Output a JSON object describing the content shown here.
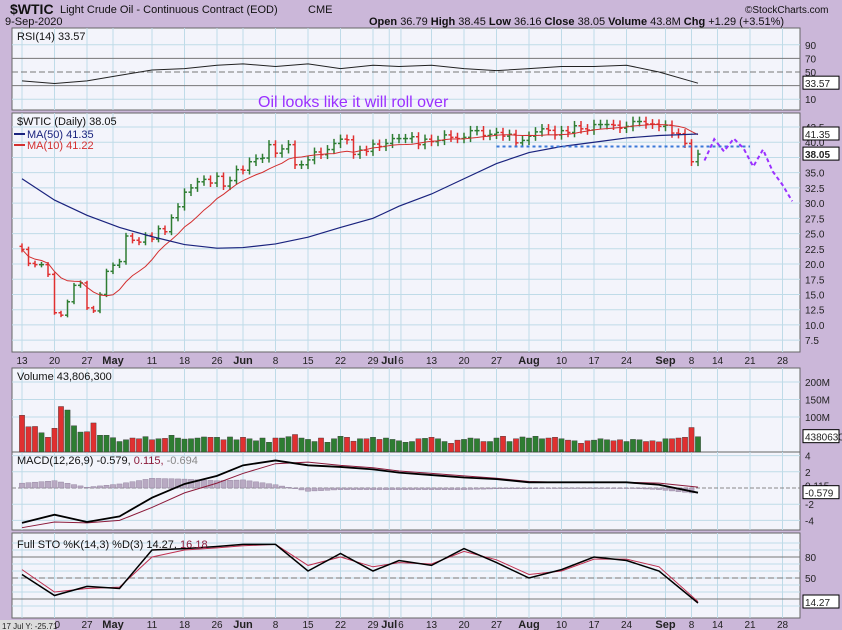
{
  "chart_data": {
    "type": "ohlc",
    "header": {
      "symbol": "$WTIC",
      "name": "Light Crude Oil - Continuous Contract (EOD)",
      "exchange": "CME",
      "date": "9-Sep-2020",
      "brand": "©StockCharts.com",
      "open_label": "Open",
      "open": "36.79",
      "high_label": "High",
      "high": "38.45",
      "low_label": "Low",
      "low": "36.16",
      "close_label": "Close",
      "close": "38.05",
      "volume_label": "Volume",
      "volume": "43.8M",
      "chg_label": "Chg",
      "chg": "+1.29 (+3.51%)"
    },
    "annotation": "Oil looks like it will roll over",
    "x_labels": [
      {
        "label": "13",
        "idx": 0
      },
      {
        "label": "20",
        "idx": 5
      },
      {
        "label": "27",
        "idx": 10
      },
      {
        "label": "May",
        "idx": 14,
        "bold": true
      },
      {
        "label": "11",
        "idx": 20
      },
      {
        "label": "18",
        "idx": 25
      },
      {
        "label": "26",
        "idx": 30
      },
      {
        "label": "Jun",
        "idx": 34,
        "bold": true
      },
      {
        "label": "8",
        "idx": 39
      },
      {
        "label": "15",
        "idx": 44
      },
      {
        "label": "22",
        "idx": 49
      },
      {
        "label": "29",
        "idx": 54
      },
      {
        "label": "Jul",
        "idx": 56.5,
        "bold": true
      },
      {
        "label": "6",
        "idx": 58.3
      },
      {
        "label": "13",
        "idx": 63
      },
      {
        "label": "20",
        "idx": 68
      },
      {
        "label": "27",
        "idx": 73
      },
      {
        "label": "Aug",
        "idx": 78,
        "bold": true
      },
      {
        "label": "10",
        "idx": 83
      },
      {
        "label": "17",
        "idx": 88
      },
      {
        "label": "24",
        "idx": 93
      },
      {
        "label": "Sep",
        "idx": 99,
        "bold": true
      },
      {
        "label": "8",
        "idx": 103
      },
      {
        "label": "14",
        "idx": 107
      },
      {
        "label": "21",
        "idx": 112
      },
      {
        "label": "28",
        "idx": 117
      }
    ],
    "bottom_readout": "17 Jul Y: -25.71",
    "price": {
      "legend": "$WTIC (Daily) 38.05",
      "ma50_label": "MA(50) 41.35",
      "ma50_last": "41.35",
      "ma10_label": "MA(10) 41.22",
      "last": "38.05",
      "ticks": [
        "42.5",
        "40.0",
        "35.0",
        "32.5",
        "30.0",
        "27.5",
        "25.0",
        "22.5",
        "20.0",
        "17.5",
        "15.0",
        "12.5",
        "10.0",
        "7.5"
      ],
      "closes": [
        22.4,
        20.1,
        19.9,
        19.9,
        18.3,
        12,
        11.6,
        13.8,
        16.5,
        16.9,
        12.8,
        12.3,
        15,
        18.8,
        19.8,
        20.4,
        24.6,
        23.9,
        23.6,
        24.7,
        24.1,
        25.8,
        25.3,
        27.6,
        29.4,
        31.8,
        32.5,
        33.5,
        33.9,
        33.3,
        34.4,
        32.8,
        33.7,
        35.5,
        35.4,
        36.8,
        37.3,
        37.4,
        39.6,
        38.2,
        38.9,
        39.6,
        36.3,
        36.3,
        37.1,
        38.4,
        37.96,
        38.8,
        39.8,
        40.5,
        40.4,
        38,
        38.7,
        38.5,
        39.7,
        39.3,
        39.8,
        40.6,
        40.6,
        40.6,
        40.9,
        39.6,
        40.5,
        40.1,
        40.3,
        41.2,
        40.8,
        40.6,
        40.8,
        41.9,
        41.9,
        41.1,
        41.3,
        41.6,
        41,
        41.3,
        39.9,
        40.3,
        41,
        41.7,
        42.2,
        41.95,
        41.2,
        41.9,
        41.6,
        42.7,
        42.2,
        42,
        42.9,
        42.9,
        42.9,
        42.8,
        42.3,
        42.6,
        43.4,
        43.4,
        43,
        42.97,
        42.6,
        42.8,
        41.5,
        41.4,
        39.8,
        36.8,
        38.05
      ],
      "ma50": {
        "idx": [
          0,
          5,
          10,
          15,
          20,
          25,
          30,
          34,
          39,
          44,
          49,
          54,
          58,
          63,
          68,
          73,
          78,
          83,
          88,
          93,
          98,
          104
        ],
        "values": [
          34,
          30.5,
          28,
          26,
          24.5,
          23.2,
          22.6,
          22.7,
          23.3,
          24.4,
          26,
          27.5,
          29.5,
          31.5,
          34,
          36.5,
          38.3,
          39.3,
          40,
          40.7,
          41.1,
          41.35
        ]
      },
      "support_level": 39.3,
      "forecast": {
        "idx": [
          105,
          106.5,
          108,
          109.5,
          111,
          112.5,
          114,
          115.5,
          117,
          118.5
        ],
        "values": [
          37,
          40.5,
          38.5,
          40.6,
          39,
          36,
          38.8,
          35.2,
          33,
          30.3
        ]
      }
    },
    "rsi": {
      "label": "RSI(14) 33.57",
      "last": "33.57",
      "ticks": [
        "90",
        "70",
        "50",
        "10"
      ],
      "idx": [
        0,
        5,
        10,
        15,
        20,
        25,
        30,
        34,
        39,
        44,
        49,
        54,
        58,
        63,
        68,
        73,
        78,
        83,
        88,
        93,
        98,
        104
      ],
      "values": [
        37,
        33,
        37,
        45,
        53,
        55,
        60,
        62,
        58,
        62,
        55,
        60,
        58,
        60,
        55,
        52,
        55,
        58,
        58,
        60,
        50,
        33.57
      ]
    },
    "volume": {
      "label": "Volume 43,806,300",
      "last": "43806300",
      "ticks": [
        "200M",
        "150M",
        "100M"
      ],
      "values_m": [
        105,
        72,
        73,
        55,
        42,
        68,
        130,
        120,
        75,
        57,
        58,
        83,
        48,
        48,
        41,
        30,
        35,
        40,
        38,
        44,
        35,
        38,
        39,
        48,
        40,
        37,
        38,
        40,
        43,
        42,
        42,
        35,
        43,
        35,
        42,
        38,
        32,
        40,
        28,
        40,
        40,
        44,
        50,
        40,
        36,
        30,
        40,
        28,
        38,
        45,
        42,
        31,
        38,
        38,
        42,
        36,
        40,
        36,
        32,
        28,
        30,
        38,
        39,
        42,
        38,
        30,
        25,
        34,
        36,
        40,
        38,
        30,
        30,
        40,
        45,
        30,
        38,
        43,
        40,
        45,
        38,
        40,
        42,
        38,
        34,
        32,
        25,
        32,
        34,
        38,
        35,
        32,
        35,
        30,
        36,
        35,
        30,
        32,
        29,
        38,
        38,
        40,
        42,
        70,
        43.8
      ]
    },
    "macd": {
      "label": "MACD(12,26,9) -0.579,",
      "signal_text": "0.115,",
      "hist_text": "-0.694",
      "last": "-0.579",
      "signal_last": "0.115",
      "ticks": [
        "4",
        "2",
        "-2",
        "-4"
      ],
      "idx": [
        0,
        5,
        10,
        15,
        20,
        25,
        30,
        34,
        39,
        44,
        49,
        54,
        58,
        63,
        68,
        73,
        78,
        83,
        88,
        93,
        98,
        104
      ],
      "macd": [
        -4.3,
        -3.3,
        -4.2,
        -3.5,
        -1.2,
        0.5,
        1.5,
        2.8,
        3.4,
        2.8,
        2.6,
        2.3,
        1.9,
        1.6,
        1.3,
        1.1,
        0.7,
        0.7,
        0.7,
        0.7,
        0.4,
        -0.579
      ],
      "signal": [
        -4.9,
        -4.2,
        -4.3,
        -4.0,
        -2.4,
        -0.6,
        0.6,
        1.8,
        3.0,
        3.2,
        2.8,
        2.5,
        2.1,
        1.8,
        1.5,
        1.2,
        0.8,
        0.7,
        0.7,
        0.7,
        0.6,
        0.115
      ]
    },
    "sto": {
      "label": "Full STO %K(14,3) %D(3) 14.27,",
      "d_text": "16.18",
      "last": "14.27",
      "ticks": [
        "80",
        "50"
      ],
      "idx": [
        0,
        5,
        10,
        15,
        20,
        25,
        30,
        34,
        39,
        44,
        49,
        54,
        58,
        63,
        68,
        73,
        78,
        83,
        88,
        93,
        98,
        104
      ],
      "k": [
        55,
        25,
        38,
        35,
        90,
        92,
        95,
        98,
        98,
        60,
        85,
        60,
        75,
        68,
        92,
        72,
        50,
        62,
        80,
        75,
        60,
        14.27
      ],
      "d": [
        62,
        30,
        35,
        37,
        80,
        90,
        93,
        96,
        98,
        68,
        80,
        66,
        72,
        70,
        88,
        76,
        55,
        60,
        77,
        77,
        66,
        16.18
      ]
    },
    "colors": {
      "up": "#2e7d32",
      "down": "#e03030",
      "ma50": "#1a237e",
      "ma10": "#d32f2f",
      "forecast": "#9b30ff",
      "support": "#3a78d8",
      "annotation": "#9b30ff"
    }
  }
}
